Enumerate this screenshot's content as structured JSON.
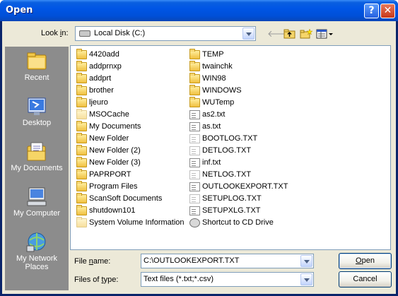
{
  "window": {
    "title": "Open",
    "help_glyph": "?",
    "close_glyph": "✕"
  },
  "toolbar": {
    "lookin_label_pre": "Look ",
    "lookin_label_acc": "i",
    "lookin_label_post": "n:",
    "lookin_value": "Local Disk (C:)",
    "icons": [
      "back-icon",
      "up-folder-icon",
      "new-folder-icon",
      "view-menu-icon"
    ]
  },
  "places": [
    {
      "label": "Recent",
      "icon": "recent-icon"
    },
    {
      "label": "Desktop",
      "icon": "desktop-icon"
    },
    {
      "label": "My Documents",
      "icon": "my-documents-icon"
    },
    {
      "label": "My Computer",
      "icon": "my-computer-icon"
    },
    {
      "label": "My Network Places",
      "icon": "network-icon"
    }
  ],
  "files": {
    "col1": [
      {
        "name": "4420add",
        "type": "folder"
      },
      {
        "name": "addprnxp",
        "type": "folder"
      },
      {
        "name": "addprt",
        "type": "folder"
      },
      {
        "name": "brother",
        "type": "folder"
      },
      {
        "name": "ljeuro",
        "type": "folder"
      },
      {
        "name": "MSOCache",
        "type": "folder-sys"
      },
      {
        "name": "My Documents",
        "type": "folder"
      },
      {
        "name": "New Folder",
        "type": "folder"
      },
      {
        "name": "New Folder (2)",
        "type": "folder"
      },
      {
        "name": "New Folder (3)",
        "type": "folder"
      },
      {
        "name": "PAPRPORT",
        "type": "folder"
      },
      {
        "name": "Program Files",
        "type": "folder"
      },
      {
        "name": "ScanSoft Documents",
        "type": "folder"
      },
      {
        "name": "shutdown101",
        "type": "folder"
      },
      {
        "name": "System Volume Information",
        "type": "folder-sys"
      }
    ],
    "col2": [
      {
        "name": "TEMP",
        "type": "folder"
      },
      {
        "name": "twainchk",
        "type": "folder"
      },
      {
        "name": "WIN98",
        "type": "folder"
      },
      {
        "name": "WINDOWS",
        "type": "folder"
      },
      {
        "name": "WUTemp",
        "type": "folder"
      },
      {
        "name": "as2.txt",
        "type": "txt"
      },
      {
        "name": "as.txt",
        "type": "txt"
      },
      {
        "name": "BOOTLOG.TXT",
        "type": "txt-pale"
      },
      {
        "name": "DETLOG.TXT",
        "type": "txt-pale"
      },
      {
        "name": "inf.txt",
        "type": "txt"
      },
      {
        "name": "NETLOG.TXT",
        "type": "txt-pale"
      },
      {
        "name": "OUTLOOKEXPORT.TXT",
        "type": "txt"
      },
      {
        "name": "SETUPLOG.TXT",
        "type": "txt-pale"
      },
      {
        "name": "SETUPXLG.TXT",
        "type": "txt"
      },
      {
        "name": "Shortcut to CD Drive",
        "type": "shortcut"
      }
    ]
  },
  "filename": {
    "label_pre": "File ",
    "label_acc": "n",
    "label_post": "ame:",
    "value": "C:\\OUTLOOKEXPORT.TXT"
  },
  "filetype": {
    "label_pre": "Files of ",
    "label_acc": "t",
    "label_post": "ype:",
    "value": "Text files (*.txt;*.csv)"
  },
  "buttons": {
    "open_acc": "O",
    "open_rest": "pen",
    "cancel": "Cancel"
  }
}
